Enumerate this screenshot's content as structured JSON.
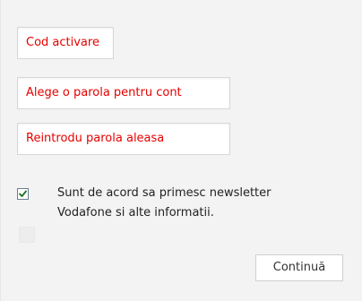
{
  "form": {
    "activation_code": {
      "placeholder": "Cod activare"
    },
    "password": {
      "placeholder": "Alege o parola pentru cont"
    },
    "password_confirm": {
      "placeholder": "Reintrodu parola aleasa"
    },
    "newsletter": {
      "checked": true,
      "label": "Sunt de acord sa primesc newsletter Vodafone si alte informatii."
    },
    "submit_label": "Continuă"
  },
  "colors": {
    "placeholder_text": "#e60000",
    "background": "#f3f3f3",
    "checkmark": "#1e6e1e"
  }
}
